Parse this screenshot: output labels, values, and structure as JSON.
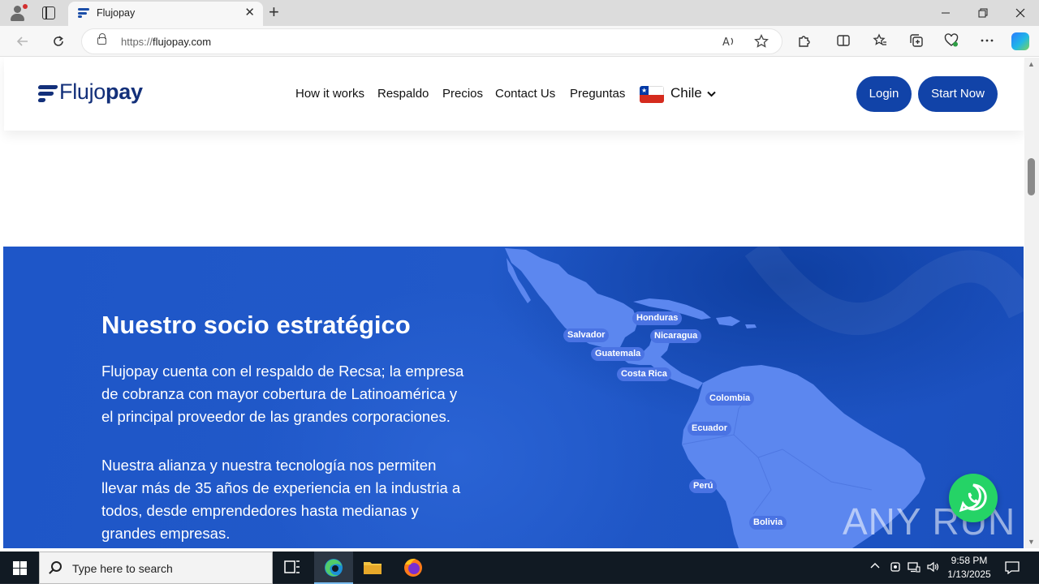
{
  "browser": {
    "tab_title": "Flujopay",
    "url_prefix": "https://",
    "url_domain": "flujopay.com",
    "new_tab_symbol": "+",
    "close_symbol": "✕"
  },
  "site": {
    "logo_light": "Flujo",
    "logo_bold": "pay",
    "nav": {
      "how": "How it works",
      "respaldo": "Respaldo",
      "precios": "Precios",
      "contact": "Contact Us",
      "preguntas": "Preguntas"
    },
    "country": "Chile",
    "login_label": "Login",
    "start_label": "Start Now",
    "brand_color": "#1143a8"
  },
  "hero": {
    "title": "Nuestro socio estratégico",
    "p1_l1": "Flujopay cuenta con el respaldo de Recsa; la empresa",
    "p1_l2": "de cobranza con mayor cobertura de Latinoamérica y",
    "p1_l3": "el principal proveedor de las grandes corporaciones.",
    "p2_l1": "Nuestra alianza y nuestra tecnología nos permiten",
    "p2_l2": "llevar más de 35 años de experiencia en la industria a",
    "p2_l3": "todos, desde emprendedores hasta medianas y",
    "p2_l4": "grandes empresas.",
    "countries": {
      "honduras": "Honduras",
      "salvador": "Salvador",
      "nicaragua": "Nicaragua",
      "guatemala": "Guatemala",
      "costa_rica": "Costa Rica",
      "colombia": "Colombia",
      "ecuador": "Ecuador",
      "peru": "Perú",
      "bolivia": "Bolivia"
    }
  },
  "watermark": "ANY RUN",
  "taskbar": {
    "search_placeholder": "Type here to search",
    "time": "9:58 PM",
    "date": "1/13/2025"
  }
}
